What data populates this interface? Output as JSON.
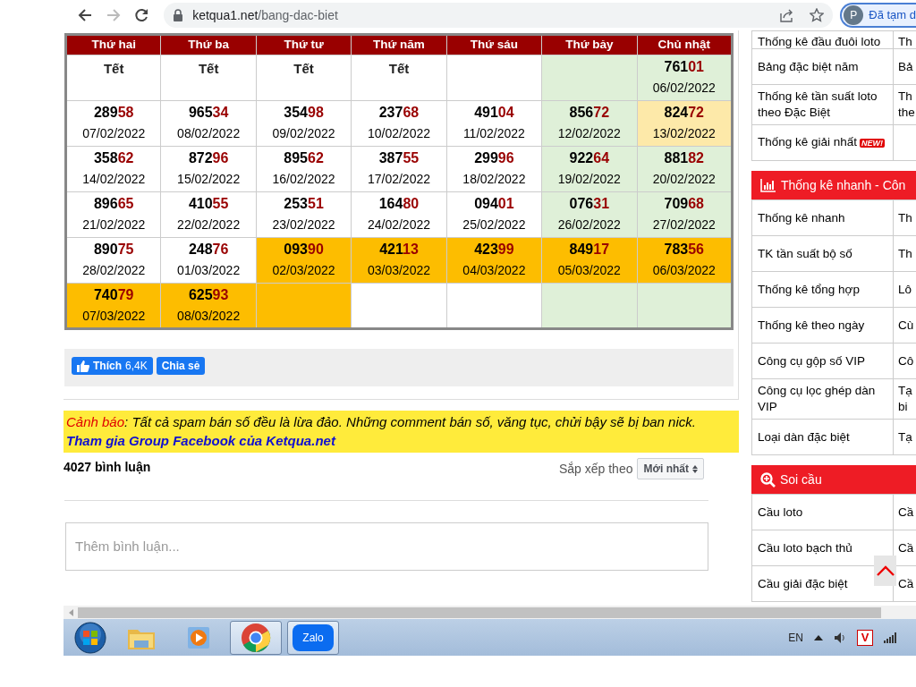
{
  "browser": {
    "back_enabled": true,
    "forward_enabled": false,
    "url_host": "ketqua1.net",
    "url_path": "/bang-dac-biet",
    "profile_initial": "P",
    "profile_label": "Đã tạm d"
  },
  "calendar": {
    "columns": [
      "Thứ hai",
      "Thứ ba",
      "Thứ tư",
      "Thứ năm",
      "Thứ sáu",
      "Thứ bảy",
      "Chủ nhật"
    ],
    "weeks": [
      [
        {
          "kind": "holiday",
          "label": "Tết",
          "color": "#ffffff"
        },
        {
          "kind": "holiday",
          "label": "Tết",
          "color": "#ffffff"
        },
        {
          "kind": "holiday",
          "label": "Tết",
          "color": "#ffffff"
        },
        {
          "kind": "holiday",
          "label": "Tết",
          "color": "#ffffff"
        },
        {
          "kind": "empty",
          "color": "#ffffff"
        },
        {
          "kind": "empty",
          "color": "#dff0d8"
        },
        {
          "kind": "result",
          "number": "76101",
          "date": "06/02/2022",
          "color": "#dff0d8"
        }
      ],
      [
        {
          "kind": "result",
          "number": "28958",
          "date": "07/02/2022",
          "color": "#ffffff"
        },
        {
          "kind": "result",
          "number": "96534",
          "date": "08/02/2022",
          "color": "#ffffff"
        },
        {
          "kind": "result",
          "number": "35498",
          "date": "09/02/2022",
          "color": "#ffffff"
        },
        {
          "kind": "result",
          "number": "23768",
          "date": "10/02/2022",
          "color": "#ffffff"
        },
        {
          "kind": "result",
          "number": "49104",
          "date": "11/02/2022",
          "color": "#ffffff"
        },
        {
          "kind": "result",
          "number": "85672",
          "date": "12/02/2022",
          "color": "#dff0d8"
        },
        {
          "kind": "result",
          "number": "82472",
          "date": "13/02/2022",
          "color": "#fde9a9"
        }
      ],
      [
        {
          "kind": "result",
          "number": "35862",
          "date": "14/02/2022",
          "color": "#ffffff"
        },
        {
          "kind": "result",
          "number": "87296",
          "date": "15/02/2022",
          "color": "#ffffff"
        },
        {
          "kind": "result",
          "number": "89562",
          "date": "16/02/2022",
          "color": "#ffffff"
        },
        {
          "kind": "result",
          "number": "38755",
          "date": "17/02/2022",
          "color": "#ffffff"
        },
        {
          "kind": "result",
          "number": "29996",
          "date": "18/02/2022",
          "color": "#ffffff"
        },
        {
          "kind": "result",
          "number": "92264",
          "date": "19/02/2022",
          "color": "#dff0d8"
        },
        {
          "kind": "result",
          "number": "88182",
          "date": "20/02/2022",
          "color": "#dff0d8"
        }
      ],
      [
        {
          "kind": "result",
          "number": "89665",
          "date": "21/02/2022",
          "color": "#ffffff"
        },
        {
          "kind": "result",
          "number": "41055",
          "date": "22/02/2022",
          "color": "#ffffff"
        },
        {
          "kind": "result",
          "number": "25351",
          "date": "23/02/2022",
          "color": "#ffffff"
        },
        {
          "kind": "result",
          "number": "16480",
          "date": "24/02/2022",
          "color": "#ffffff"
        },
        {
          "kind": "result",
          "number": "09401",
          "date": "25/02/2022",
          "color": "#ffffff"
        },
        {
          "kind": "result",
          "number": "07631",
          "date": "26/02/2022",
          "color": "#dff0d8"
        },
        {
          "kind": "result",
          "number": "70968",
          "date": "27/02/2022",
          "color": "#dff0d8"
        }
      ],
      [
        {
          "kind": "result",
          "number": "89075",
          "date": "28/02/2022",
          "color": "#ffffff"
        },
        {
          "kind": "result",
          "number": "24876",
          "date": "01/03/2022",
          "color": "#ffffff"
        },
        {
          "kind": "result",
          "number": "09390",
          "date": "02/03/2022",
          "color": "#fdbd00"
        },
        {
          "kind": "result",
          "number": "42113",
          "date": "03/03/2022",
          "color": "#fdbd00"
        },
        {
          "kind": "result",
          "number": "42399",
          "date": "04/03/2022",
          "color": "#fdbd00"
        },
        {
          "kind": "result",
          "number": "84917",
          "date": "05/03/2022",
          "color": "#fdbd00"
        },
        {
          "kind": "result",
          "number": "78356",
          "date": "06/03/2022",
          "color": "#fdbd00"
        }
      ],
      [
        {
          "kind": "result",
          "number": "74079",
          "date": "07/03/2022",
          "color": "#fdbd00"
        },
        {
          "kind": "result",
          "number": "62593",
          "date": "08/03/2022",
          "color": "#fdbd00"
        },
        {
          "kind": "empty",
          "color": "#fdbd00"
        },
        {
          "kind": "empty",
          "color": "#ffffff"
        },
        {
          "kind": "empty",
          "color": "#ffffff"
        },
        {
          "kind": "empty",
          "color": "#dff0d8"
        },
        {
          "kind": "empty",
          "color": "#dff0d8"
        }
      ]
    ]
  },
  "social": {
    "like_label": "Thích",
    "like_count": "6,4K",
    "share_label": "Chia sẻ"
  },
  "warning": {
    "label": "Cảnh báo",
    "text": ": Tất cả spam bán số đều là lừa đảo. Những comment bán số, văng tục, chửi bậy sẽ bị ban nick.",
    "link": "Tham gia Group Facebook của Ketqua.net"
  },
  "comments": {
    "count": "4027 bình luận",
    "sort_label": "Sắp xếp theo",
    "sort_value": "Mới nhất",
    "placeholder": "Thêm bình luận..."
  },
  "sidebar": [
    {
      "rows": [
        {
          "col_1": "Thống kê đầu đuôi loto",
          "col_2": "Th"
        },
        {
          "col_1": "Bảng đặc biệt năm",
          "col_2": "Bả"
        },
        {
          "col_1": "Thống kê tần suất loto theo Đặc Biệt",
          "col_2": "Th the"
        },
        {
          "col_1": "Thống kê giải nhất",
          "badge": "NEW!"
        }
      ]
    },
    {
      "title": "Thống kê nhanh - Côn",
      "kind": "chart",
      "rows": [
        {
          "col_1": "Thống kê nhanh",
          "col_2": "Th"
        },
        {
          "col_1": "TK tần suất bộ số",
          "col_2": "Th"
        },
        {
          "col_1": "Thống kê tổng hợp",
          "col_2": "Lô"
        },
        {
          "col_1": "Thống kê theo ngày",
          "col_2": "Cù"
        },
        {
          "col_1": "Công cụ gộp số VIP",
          "col_2": "Cô"
        },
        {
          "col_1": "Công cụ lọc ghép dàn VIP",
          "col_2": "Tạ bi"
        },
        {
          "col_1": "Loại dàn đặc biệt",
          "col_2": "Tạ"
        }
      ]
    },
    {
      "title": "Soi cầu",
      "kind": "search",
      "rows": [
        {
          "col_1": "Cầu loto",
          "col_2": "Cầ"
        },
        {
          "col_1": "Cầu loto bạch thủ",
          "col_2": "Cầ"
        },
        {
          "col_1": "Cầu giải đặc biệt",
          "col_2": "Cầ"
        }
      ]
    }
  ],
  "taskbar": {
    "apps": [
      {
        "kind": "folder",
        "open": false
      },
      {
        "kind": "media",
        "open": false
      },
      {
        "kind": "browser",
        "open": true
      },
      {
        "kind": "chat",
        "open": true,
        "label": "Zalo"
      }
    ],
    "language": "EN",
    "tray_badge": "V"
  }
}
